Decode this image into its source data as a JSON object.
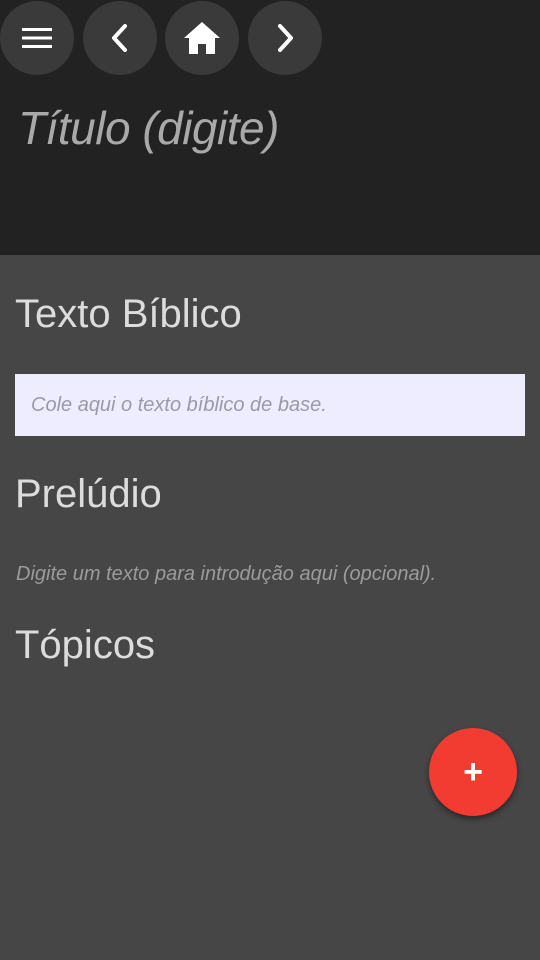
{
  "header": {
    "title_placeholder": "Título (digite)",
    "nav_buttons": [
      {
        "icon": "menu-icon"
      },
      {
        "icon": "chevron-left-icon"
      },
      {
        "icon": "home-icon"
      },
      {
        "icon": "chevron-right-icon"
      }
    ]
  },
  "sections": {
    "texto_biblico": {
      "heading": "Texto Bíblico",
      "placeholder": "Cole aqui o texto bíblico de base."
    },
    "preludio": {
      "heading": "Prelúdio",
      "placeholder": "Digite um texto para introdução aqui (opcional)."
    },
    "topicos": {
      "heading": "Tópicos"
    }
  },
  "fab": {
    "label": "+",
    "icon": "add-icon"
  },
  "colors": {
    "header_bg": "#222222",
    "body_bg": "#464646",
    "fab_bg": "#f23c32",
    "input_bg": "#ededff"
  }
}
